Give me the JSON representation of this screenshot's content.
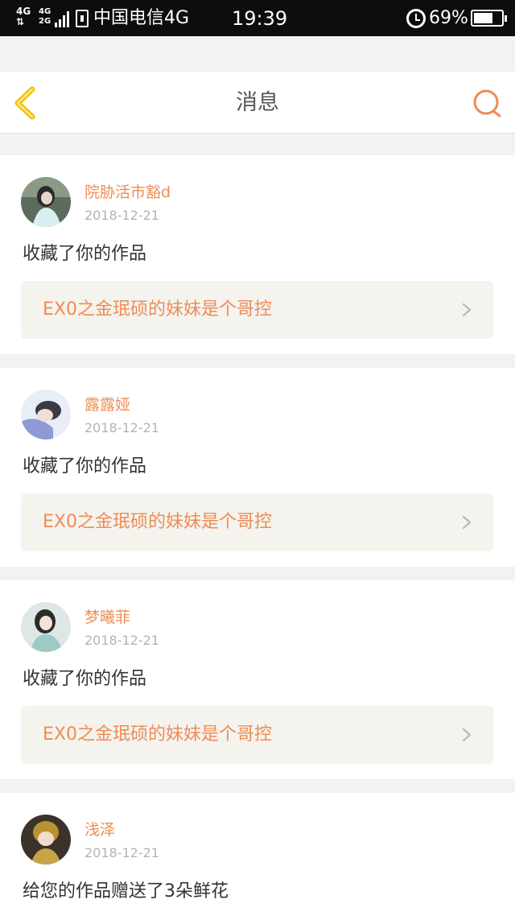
{
  "status_bar": {
    "network_top": "4G",
    "network_arrows": "⇅",
    "network_small_top": "4G",
    "network_small_bottom": "2G",
    "carrier": "中国电信4G",
    "time": "19:39",
    "battery_percent": "69%",
    "battery_level": 0.69
  },
  "header": {
    "title": "消息",
    "icons": {
      "back": "chevron-left-icon",
      "search": "search-icon"
    }
  },
  "colors": {
    "accent": "#ee8c55",
    "back_icon": "#f2c300",
    "text_dark": "#333333",
    "date_gray": "#b3b3b3",
    "link_bg": "#f4f3ee"
  },
  "messages": [
    {
      "user": "院胁活市豁d",
      "date": "2018-12-21",
      "action": "收藏了你的作品",
      "work": "EX0之金珉硕的妹妹是个哥控"
    },
    {
      "user": "露露娅",
      "date": "2018-12-21",
      "action": "收藏了你的作品",
      "work": "EX0之金珉硕的妹妹是个哥控"
    },
    {
      "user": "梦曦菲",
      "date": "2018-12-21",
      "action": "收藏了你的作品",
      "work": "EX0之金珉硕的妹妹是个哥控"
    },
    {
      "user": "浅泽",
      "date": "2018-12-21",
      "action": "给您的作品赠送了3朵鲜花"
    }
  ]
}
